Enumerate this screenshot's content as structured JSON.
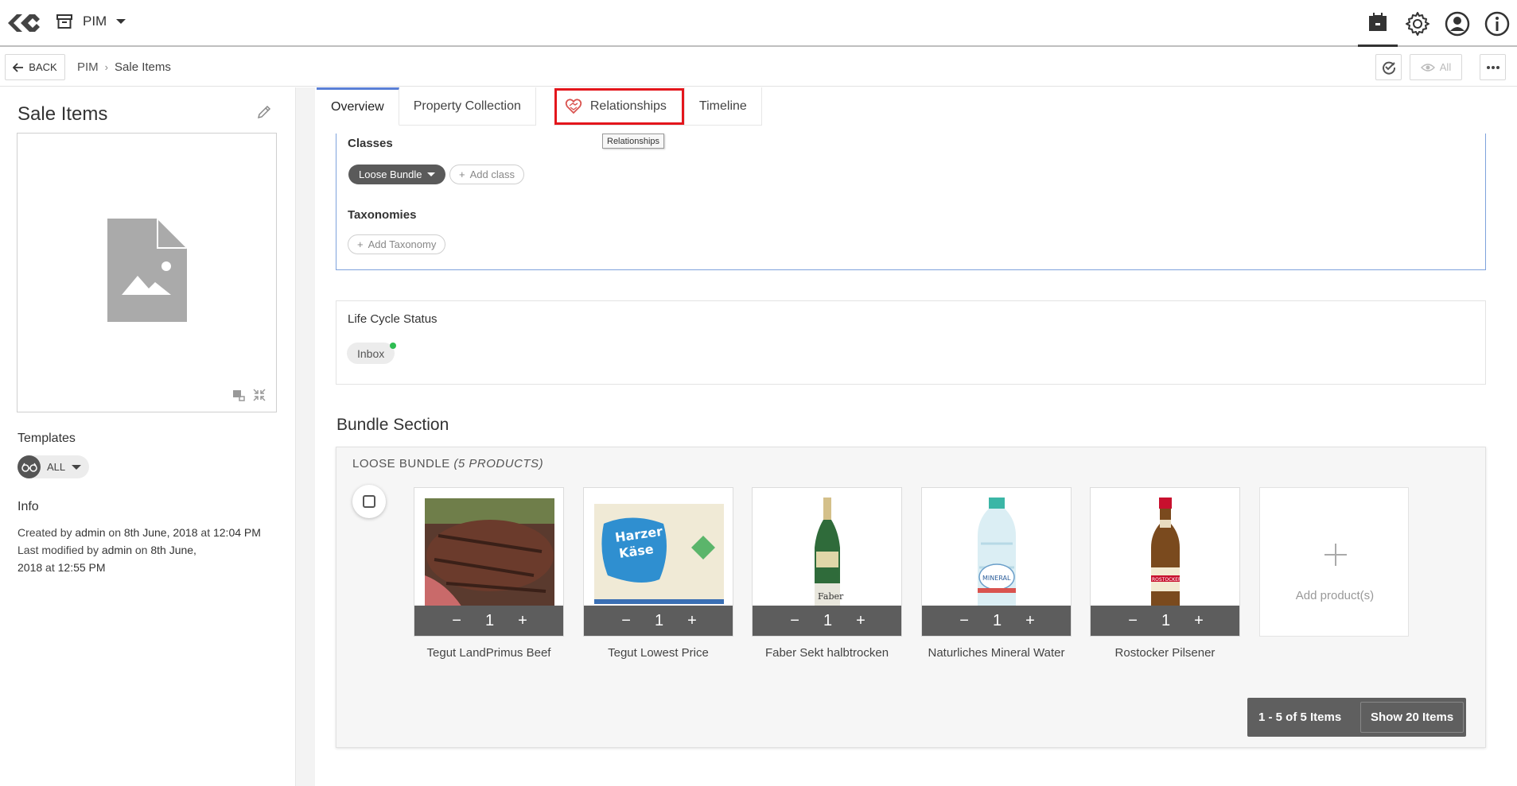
{
  "header": {
    "app_name": "PIM",
    "icons": [
      "logo-icon",
      "archive-icon",
      "caret-down-icon",
      "inbox-icon",
      "gear-icon",
      "user-icon",
      "info-icon"
    ]
  },
  "subheader": {
    "back_label": "BACK",
    "breadcrumb": [
      "PIM",
      "Sale Items"
    ],
    "view_label": "All"
  },
  "entity": {
    "title": "Sale Items",
    "templates_label": "Templates",
    "templates_value": "ALL",
    "info_label": "Info",
    "created_prefix": "Created by",
    "created_by": "admin",
    "created_on_word": "on",
    "created_date": "8th June, 2018",
    "created_at_word": "at",
    "created_time": "12:04 PM",
    "modified_prefix": "Last modified by",
    "modified_by": "admin",
    "modified_on_word": "on",
    "modified_date_1": "8th June,",
    "modified_date_2": "2018",
    "modified_at_word": "at",
    "modified_time": "12:55 PM"
  },
  "tabs": [
    {
      "label": "Overview",
      "active": true
    },
    {
      "label": "Property Collection",
      "active": false
    },
    {
      "label": "Relationships",
      "active": false,
      "highlighted": true
    },
    {
      "label": "Timeline",
      "active": false
    }
  ],
  "tooltip": "Relationships",
  "classes": {
    "title": "Classes",
    "selected": "Loose Bundle",
    "add_label": "Add class"
  },
  "taxonomies": {
    "title": "Taxonomies",
    "add_label": "Add Taxonomy"
  },
  "lifecycle": {
    "title": "Life Cycle Status",
    "status": "Inbox",
    "status_color": "#2ebd52"
  },
  "bundle": {
    "heading": "Bundle Section",
    "label": "LOOSE BUNDLE",
    "count_label": "(5 PRODUCTS)",
    "products": [
      {
        "name": "Tegut LandPrimus Beef",
        "qty": "1"
      },
      {
        "name": "Tegut Lowest Price",
        "qty": "1"
      },
      {
        "name": "Faber Sekt halbtrocken",
        "qty": "1"
      },
      {
        "name": "Naturliches Mineral Water",
        "qty": "1"
      },
      {
        "name": "Rostocker Pilsener",
        "qty": "1"
      }
    ],
    "add_product_label": "Add product(s)",
    "pager_range": "1 - 5 of 5 Items",
    "pager_show": "Show 20 Items",
    "harzer_text_1": "Harzer",
    "harzer_text_2": "Käse",
    "faber_text": "Faber",
    "water_text": "MINERAL",
    "rostocker_text": "ROSTOCKER"
  },
  "colors": {
    "accent_blue": "#5a7fd6",
    "highlight_red": "#e3161c"
  }
}
